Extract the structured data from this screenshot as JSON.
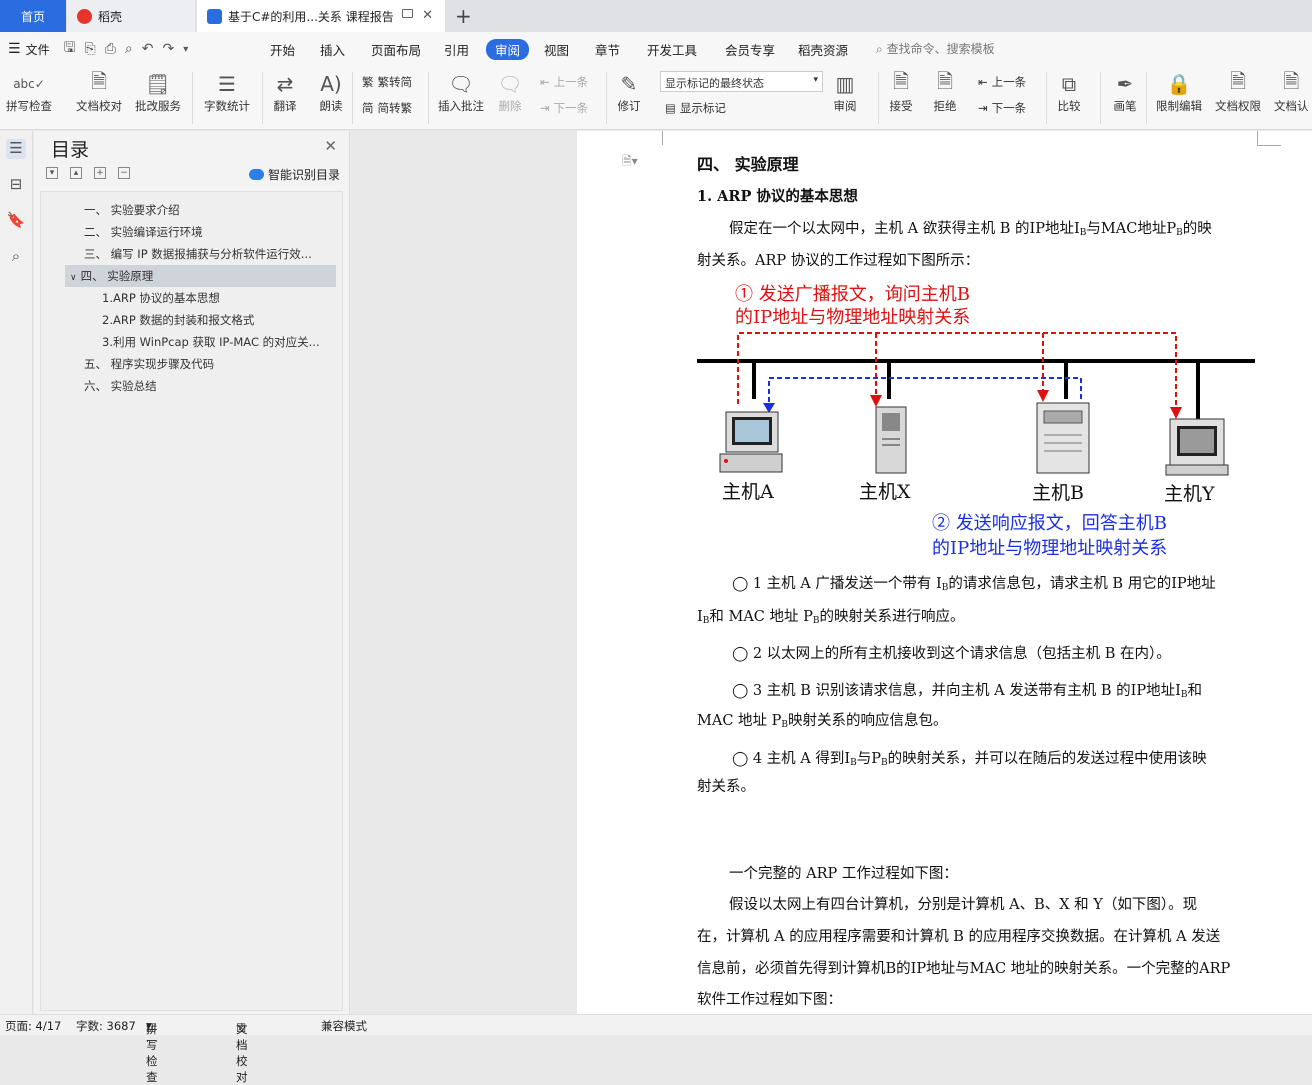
{
  "tabs": {
    "home": "首页",
    "daoke": "稻壳",
    "doc": "基于C#的利用...关系 课程报告"
  },
  "menubar": {
    "file": "文件",
    "items": [
      "开始",
      "插入",
      "页面布局",
      "引用",
      "审阅",
      "视图",
      "章节",
      "开发工具",
      "会员专享",
      "稻壳资源"
    ],
    "search": "查找命令、搜索模板"
  },
  "ribbon": {
    "spell": "拼写检查",
    "proof": "文档校对",
    "correct": "批改服务",
    "wordcount": "字数统计",
    "translate": "翻译",
    "read": "朗读",
    "t2s": "繁转简",
    "s2t": "简转繁",
    "insert_comment": "插入批注",
    "delete": "删除",
    "prev1": "上一条",
    "next1": "下一条",
    "revise": "修订",
    "markup_state": "显示标记的最终状态",
    "show_markup": "显示标记",
    "review": "审阅",
    "accept": "接受",
    "reject": "拒绝",
    "prev2": "上一条",
    "next2": "下一条",
    "compare": "比较",
    "pen": "画笔",
    "restrict": "限制编辑",
    "perm": "文档权限",
    "cert": "文档认"
  },
  "toc": {
    "title": "目录",
    "smart": "智能识别目录",
    "items": [
      "一、  实验要求介绍",
      "二、  实验编译运行环境",
      "三、  编写 IP 数据报捕获与分析软件运行效...",
      "四、  实验原理",
      "1.ARP 协议的基本思想",
      "2.ARP 数据的封装和报文格式",
      "3.利用 WinPcap 获取 IP-MAC 的对应关...",
      "五、  程序实现步骤及代码",
      "六、  实验总结"
    ]
  },
  "doc": {
    "h_section": "四、    实验原理",
    "h_sub": "1.  ARP 协议的基本思想",
    "p1a": "假定在一个以太网中，主机 A 欲获得主机 B 的IP地址I",
    "p1a_sub": "B",
    "p1b": "与MAC地址P",
    "p1b_sub": "B",
    "p1c": "的映",
    "p1d": "射关系。ARP 协议的工作过程如下图所示：",
    "diagram": {
      "red1": "①  发送广播报文，询问主机B",
      "red2": "的IP地址与物理地址映射关系",
      "blue1": "②  发送响应报文，回答主机B",
      "blue2": "的IP地址与物理地址映射关系",
      "hosts": [
        "主机A",
        "主机X",
        "主机B",
        "主机Y"
      ]
    },
    "s1a": "◯ 1 主机 A 广播发送一个带有 I",
    "s1_sub": "B",
    "s1b": "的请求信息包，请求主机 B 用它的IP地址",
    "s1c": "I",
    "s1d": "和 MAC 地址 P",
    "s1e": "的映射关系进行响应。",
    "s2": "◯ 2 以太网上的所有主机接收到这个请求信息（包括主机 B 在内）。",
    "s3a": "◯ 3 主机 B 识别该请求信息，并向主机 A 发送带有主机 B 的IP地址I",
    "s3b": "和",
    "s3c": "MAC 地址 P",
    "s3d": "映射关系的响应信息包。",
    "s4a": "◯ 4 主机 A 得到I",
    "s4b": "与P",
    "s4c": "的映射关系，并可以在随后的发送过程中使用该映",
    "s4d": "射关系。",
    "p2": "一个完整的 ARP 工作过程如下图：",
    "p3a": "假设以太网上有四台计算机，分别是计算机 A、B、X 和 Y（如下图）。现",
    "p3b": "在，计算机 A 的应用程序需要和计算机 B 的应用程序交换数据。在计算机 A 发送",
    "p3c": "信息前，必须首先得到计算机B的IP地址与MAC 地址的映射关系。一个完整的ARP",
    "p3d": "软件工作过程如下图："
  },
  "status": {
    "page": "页面: 4/17",
    "words": "字数: 3687",
    "spell": "拼写检查",
    "proof": "文档校对",
    "compat": "兼容模式"
  },
  "colors": {
    "accent": "#2b6de0",
    "red": "#e01010",
    "blue": "#1a2fe0"
  }
}
